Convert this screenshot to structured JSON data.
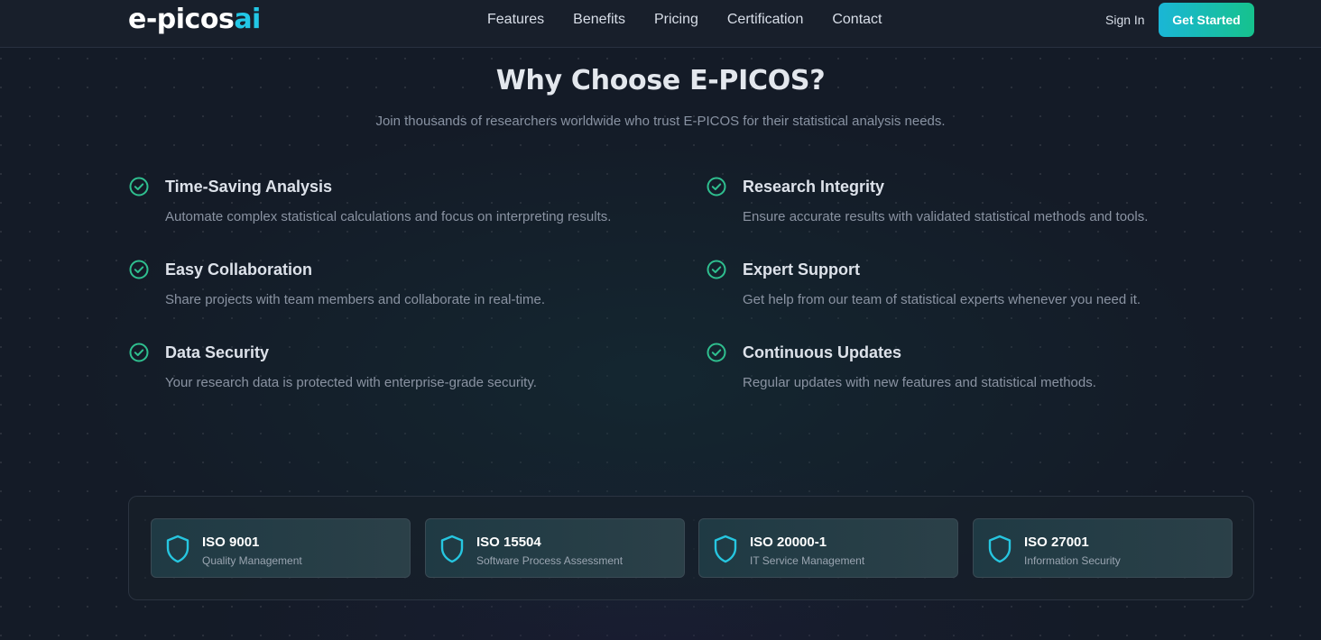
{
  "header": {
    "logo_main": "e-picos",
    "logo_accent": "ai",
    "nav": [
      "Features",
      "Benefits",
      "Pricing",
      "Certification",
      "Contact"
    ],
    "sign_in": "Sign In",
    "get_started": "Get Started"
  },
  "section": {
    "title": "Why Choose E-PICOS?",
    "subtitle": "Join thousands of researchers worldwide who trust E-PICOS for their statistical analysis needs."
  },
  "features": [
    {
      "title": "Time-Saving Analysis",
      "desc": "Automate complex statistical calculations and focus on interpreting results.",
      "icon": "check-circle-icon"
    },
    {
      "title": "Research Integrity",
      "desc": "Ensure accurate results with validated statistical methods and tools.",
      "icon": "check-circle-icon"
    },
    {
      "title": "Easy Collaboration",
      "desc": "Share projects with team members and collaborate in real-time.",
      "icon": "check-circle-icon"
    },
    {
      "title": "Expert Support",
      "desc": "Get help from our team of statistical experts whenever you need it.",
      "icon": "check-circle-icon"
    },
    {
      "title": "Data Security",
      "desc": "Your research data is protected with enterprise-grade security.",
      "icon": "check-circle-icon"
    },
    {
      "title": "Continuous Updates",
      "desc": "Regular updates with new features and statistical methods.",
      "icon": "check-circle-icon"
    }
  ],
  "certifications": [
    {
      "name": "ISO 9001",
      "desc": "Quality Management",
      "icon": "shield-icon"
    },
    {
      "name": "ISO 15504",
      "desc": "Software Process Assessment",
      "icon": "shield-icon"
    },
    {
      "name": "ISO 20000-1",
      "desc": "IT Service Management",
      "icon": "shield-icon"
    },
    {
      "name": "ISO 27001",
      "desc": "Information Security",
      "icon": "shield-icon"
    }
  ],
  "colors": {
    "accent_cyan": "#22c7e6",
    "accent_green": "#16c28d",
    "check_green": "#2fbf8f",
    "shield_cyan": "#26c6e0",
    "background": "#141b27"
  }
}
